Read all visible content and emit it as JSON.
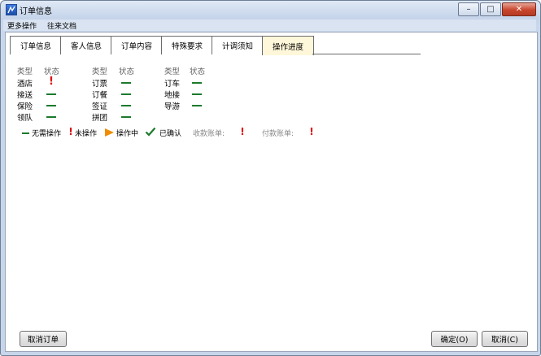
{
  "window": {
    "title": "订单信息"
  },
  "controls": {
    "minimize": "–",
    "maximize": "□",
    "close": "✕"
  },
  "menubar": {
    "items": [
      "更多操作",
      "往来文档"
    ]
  },
  "tabs": [
    {
      "label": "订单信息",
      "active": false
    },
    {
      "label": "客人信息",
      "active": false
    },
    {
      "label": "订单内容",
      "active": false
    },
    {
      "label": "特殊要求",
      "active": false
    },
    {
      "label": "计调须知",
      "active": false
    },
    {
      "label": "操作进度",
      "active": true
    }
  ],
  "progress": {
    "header_type": "类型",
    "header_status": "状态",
    "col1": [
      {
        "name": "酒店",
        "status": "未操作"
      },
      {
        "name": "接送",
        "status": "无需操作"
      },
      {
        "name": "保险",
        "status": "无需操作"
      },
      {
        "name": "领队",
        "status": "无需操作"
      }
    ],
    "col2": [
      {
        "name": "订票",
        "status": "无需操作"
      },
      {
        "name": "订餐",
        "status": "无需操作"
      },
      {
        "name": "签证",
        "status": "无需操作"
      },
      {
        "name": "拼团",
        "status": "无需操作"
      }
    ],
    "col3": [
      {
        "name": "订车",
        "status": "无需操作"
      },
      {
        "name": "地接",
        "status": "无需操作"
      },
      {
        "name": "导游",
        "status": "无需操作"
      }
    ]
  },
  "legend": {
    "none": "无需操作",
    "pending": "未操作",
    "in_progress": "操作中",
    "confirmed": "已确认",
    "receivable": "收款账单:",
    "payable": "付款账单:"
  },
  "colors": {
    "dash": "#1b7a2c",
    "alert": "#e00000",
    "in_progress": "#f08c00",
    "check": "#1b7a2c",
    "active_tab": "#fff7d9"
  },
  "buttons": {
    "cancel_order": "取消订单",
    "ok": "确定(O)",
    "cancel": "取消(C)"
  }
}
